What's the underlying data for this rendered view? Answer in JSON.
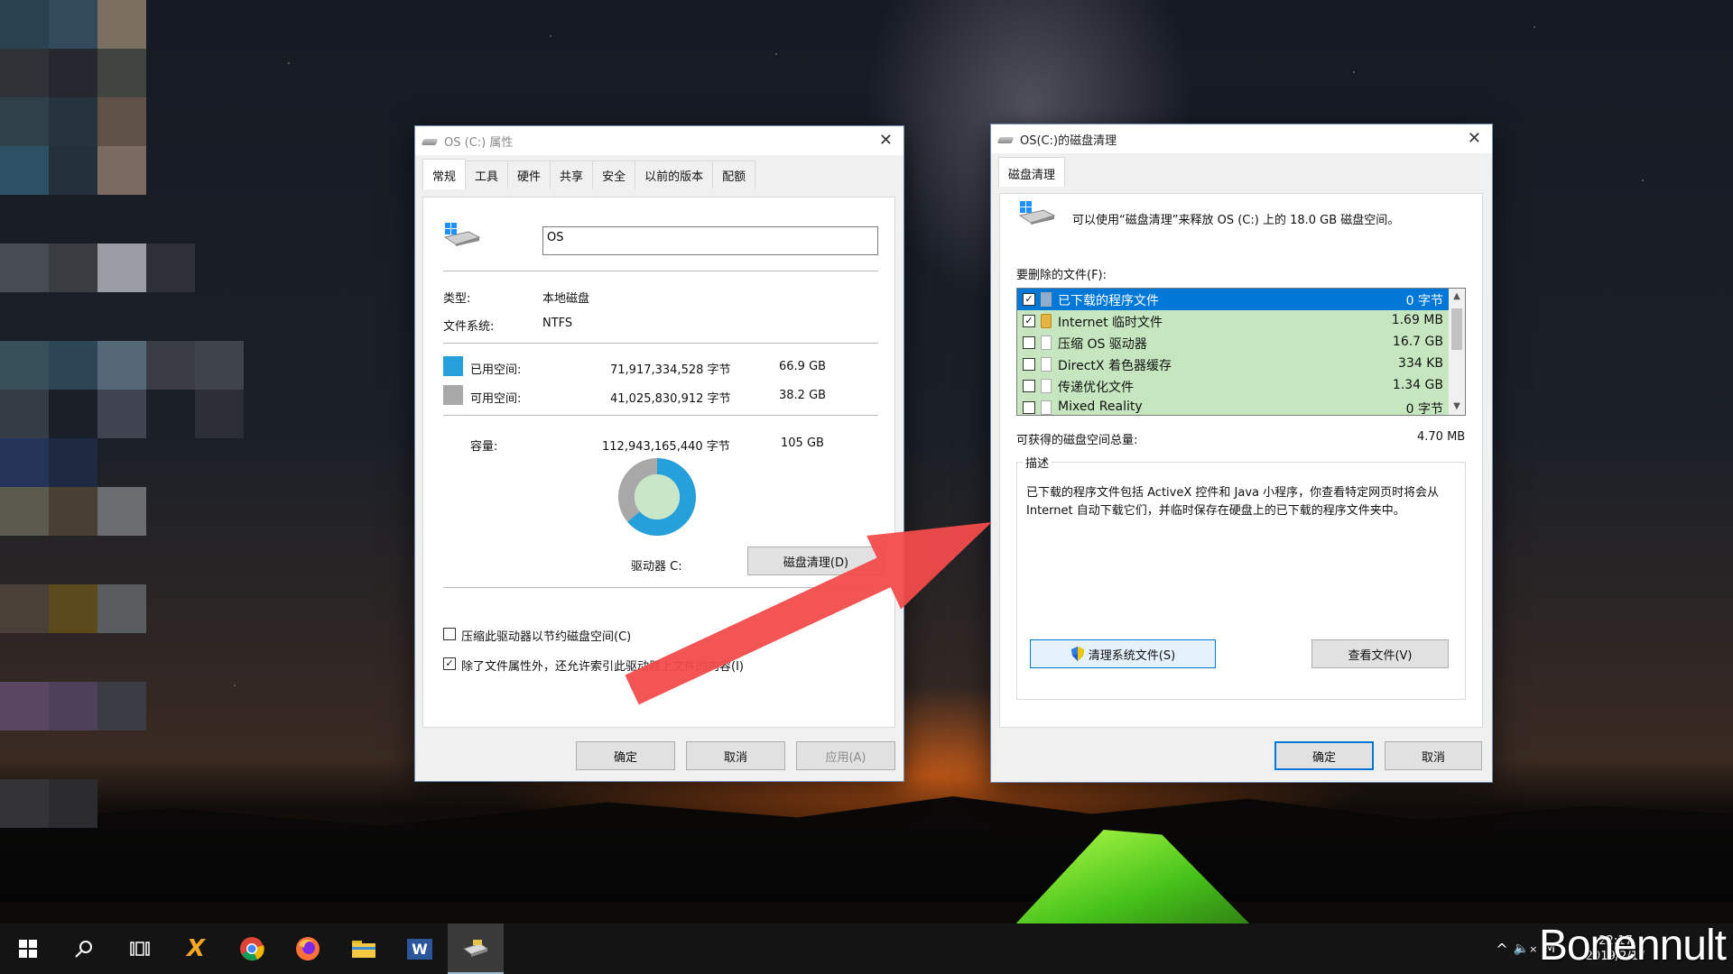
{
  "props_window": {
    "title": "OS (C:) 属性",
    "tabs": [
      "常规",
      "工具",
      "硬件",
      "共享",
      "安全",
      "以前的版本",
      "配额"
    ],
    "drive_name_value": "OS",
    "type_label": "类型:",
    "type_value": "本地磁盘",
    "fs_label": "文件系统:",
    "fs_value": "NTFS",
    "used_label": "已用空间:",
    "used_bytes": "71,917,334,528 字节",
    "used_gb": "66.9 GB",
    "free_label": "可用空间:",
    "free_bytes": "41,025,830,912 字节",
    "free_gb": "38.2 GB",
    "capacity_label": "容量:",
    "capacity_bytes": "112,943,165,440 字节",
    "capacity_gb": "105 GB",
    "drive_label": "驱动器 C:",
    "cleanup_button": "磁盘清理(D)",
    "compress_option": "压缩此驱动器以节约磁盘空间(C)",
    "index_option": "除了文件属性外，还允许索引此驱动器上文件的内容(I)",
    "ok_button": "确定",
    "cancel_button": "取消",
    "apply_button": "应用(A)",
    "used_color": "#26a0da",
    "free_color": "#a8a8a8",
    "used_fraction": 0.637
  },
  "cleanup_window": {
    "title": "OS(C:)的磁盘清理",
    "tab": "磁盘清理",
    "intro": "可以使用“磁盘清理”来释放 OS (C:) 上的 18.0 GB 磁盘空间。",
    "files_label": "要删除的文件(F):",
    "files": [
      {
        "name": "已下载的程序文件",
        "size": "0 字节",
        "checked": "✓",
        "icon": "page-icon"
      },
      {
        "name": "Internet 临时文件",
        "size": "1.69 MB",
        "checked": "✓",
        "icon": "lock-icon"
      },
      {
        "name": "压缩 OS 驱动器",
        "size": "16.7 GB",
        "checked": "",
        "icon": "page-icon"
      },
      {
        "name": "DirectX 着色器缓存",
        "size": "334 KB",
        "checked": "",
        "icon": "page-icon"
      },
      {
        "name": "传递优化文件",
        "size": "1.34 GB",
        "checked": "",
        "icon": "page-icon"
      },
      {
        "name": "Mixed Reality",
        "size": "0 字节",
        "checked": "",
        "icon": "page-icon"
      }
    ],
    "total_label": "可获得的磁盘空间总量:",
    "total_value": "4.70 MB",
    "desc_label": "描述",
    "description": "已下载的程序文件包括 ActiveX 控件和 Java 小程序，你查看特定网页时将会从 Internet 自动下载它们，并临时保存在硬盘上的已下载的程序文件夹中。",
    "clean_system_button": "清理系统文件(S)",
    "view_files_button": "查看文件(V)",
    "ok_button": "确定",
    "cancel_button": "取消"
  },
  "taskbar": {
    "apps": [
      "start-icon",
      "search-icon",
      "task-view-icon",
      "xmind-icon",
      "chrome-icon",
      "firefox-icon",
      "file-explorer-icon",
      "word-icon",
      "disk-cleanup-icon"
    ],
    "word_label": "W",
    "xmind_label": "X",
    "time": "22:17",
    "date": "2019/2/17",
    "tray_chevron": "^",
    "tray_mute": "×",
    "tray_ime": "M"
  },
  "watermark": "Bonennult"
}
